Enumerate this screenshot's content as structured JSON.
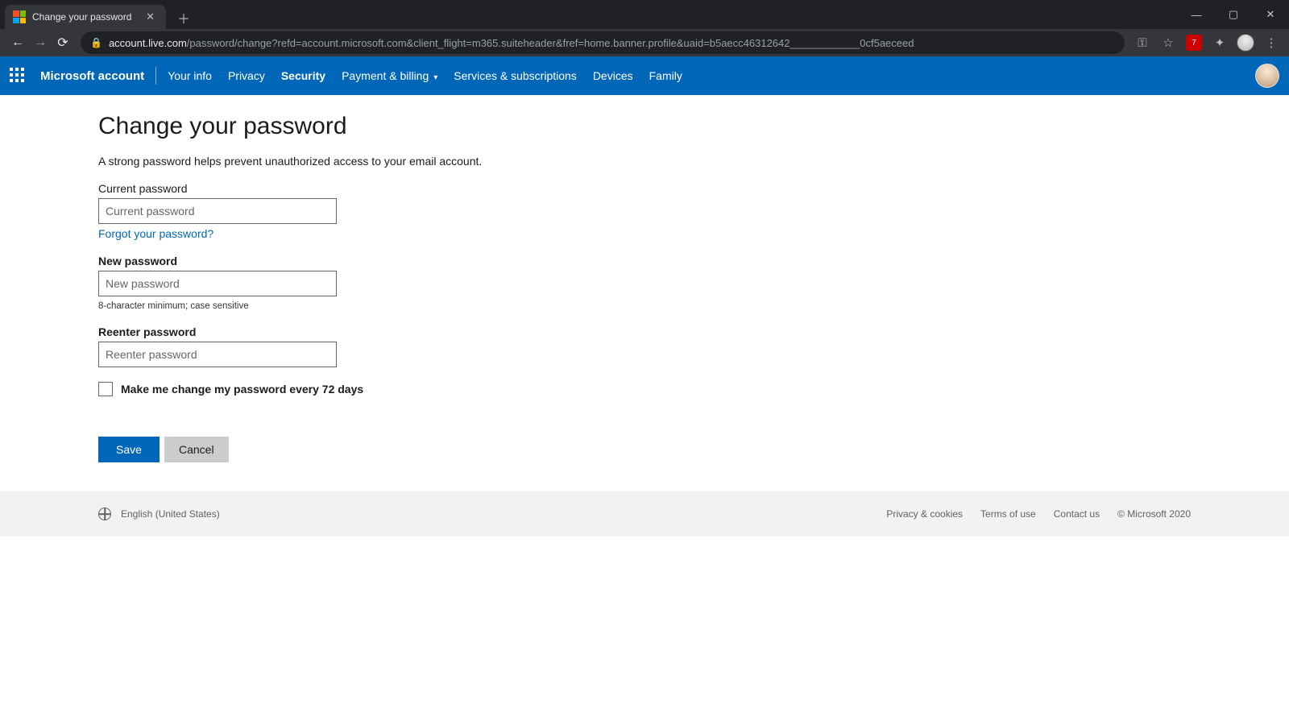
{
  "browser": {
    "tab_title": "Change your password",
    "url_host": "account.live.com",
    "url_path": "/password/change?refd=account.microsoft.com&client_flight=m365.suiteheader&fref=home.banner.profile&uaid=b5aecc46312642____________0cf5aeceed",
    "ext_badge": "7"
  },
  "nav": {
    "brand": "Microsoft account",
    "links": {
      "your_info": "Your info",
      "privacy": "Privacy",
      "security": "Security",
      "payment": "Payment & billing",
      "services": "Services & subscriptions",
      "devices": "Devices",
      "family": "Family"
    }
  },
  "page": {
    "heading": "Change your password",
    "subtext": "A strong password helps prevent unauthorized access to your email account.",
    "current": {
      "label": "Current password",
      "placeholder": "Current password",
      "forgot": "Forgot your password?"
    },
    "new": {
      "label": "New password",
      "placeholder": "New password",
      "hint": "8-character minimum; case sensitive"
    },
    "reenter": {
      "label": "Reenter password",
      "placeholder": "Reenter password"
    },
    "checkbox_label": "Make me change my password every 72 days",
    "save": "Save",
    "cancel": "Cancel"
  },
  "footer": {
    "language": "English (United States)",
    "privacy": "Privacy & cookies",
    "terms": "Terms of use",
    "contact": "Contact us",
    "copyright": "© Microsoft 2020"
  }
}
